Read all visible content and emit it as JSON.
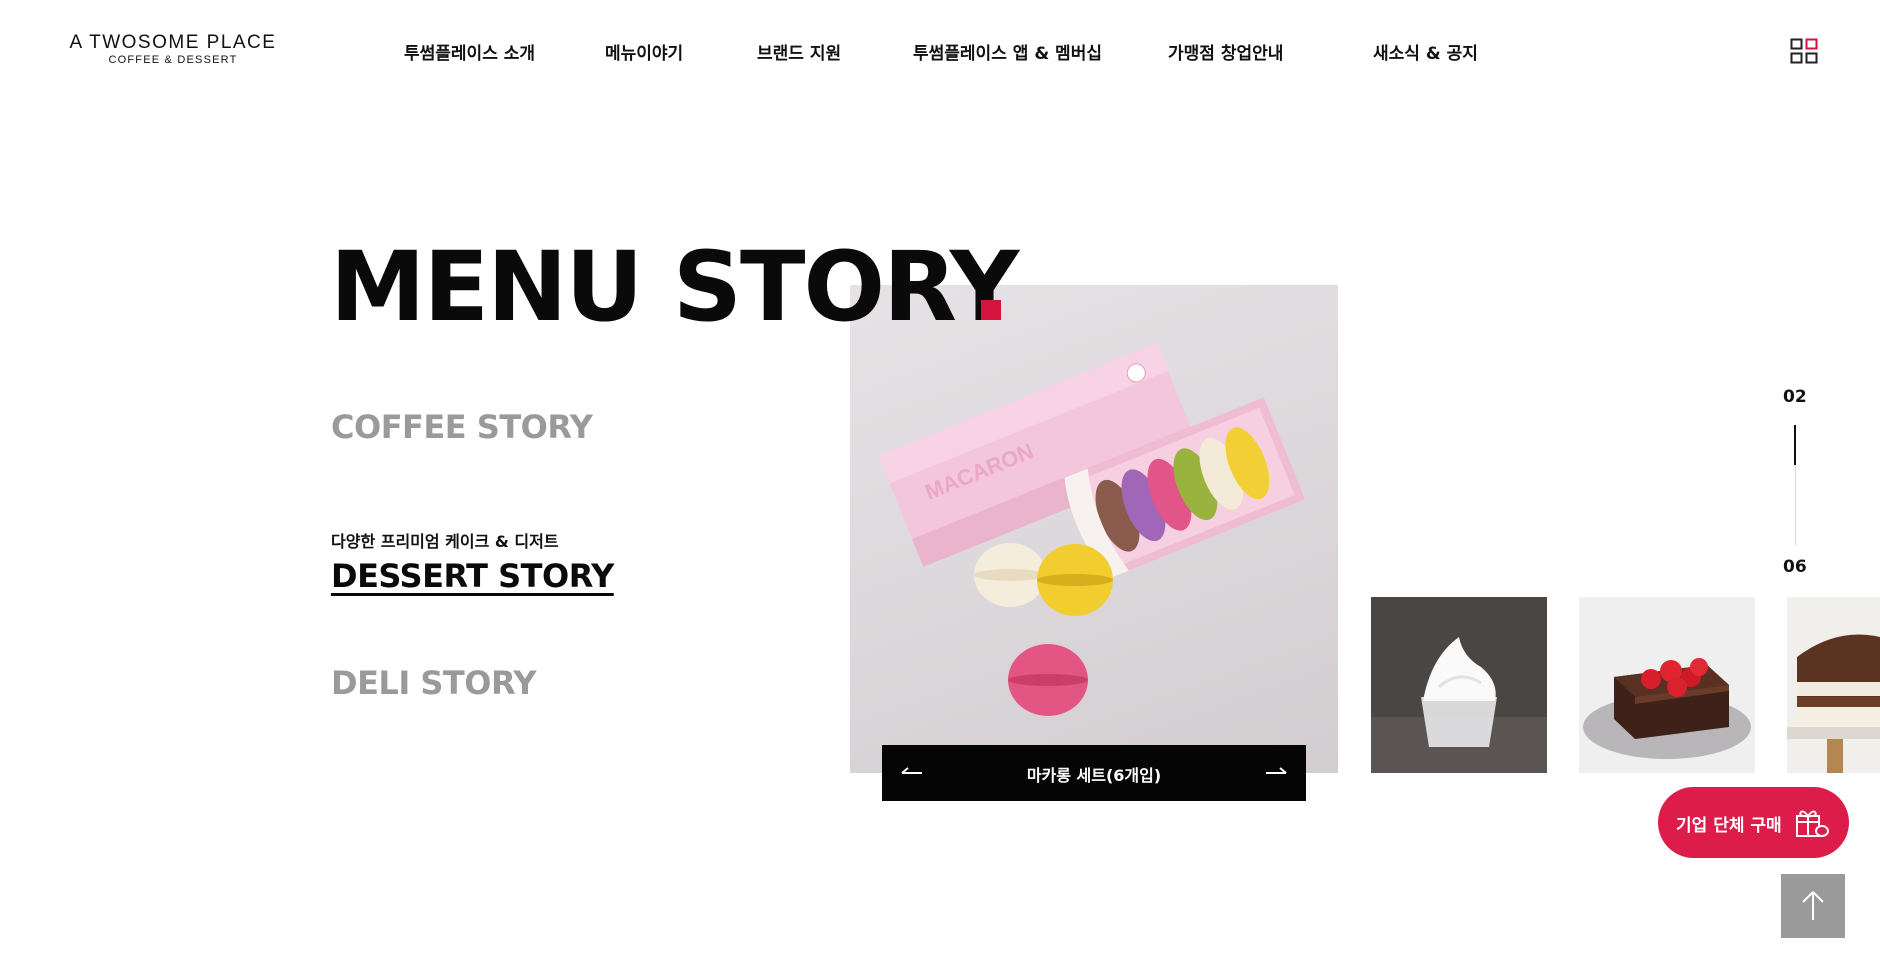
{
  "brand": {
    "name": "A TWOSOME PLACE",
    "tagline": "COFFEE & DESSERT"
  },
  "nav": {
    "items": [
      {
        "label": "투썸플레이스 소개"
      },
      {
        "label": "메뉴이야기"
      },
      {
        "label": "브랜드 지원"
      },
      {
        "label": "투썸플레이스 앱 & 멤버십"
      },
      {
        "label": "가맹점 창업안내"
      },
      {
        "label": "새소식 & 공지"
      }
    ],
    "menu_icon": "grid-menu-icon"
  },
  "section": {
    "title": "MENU STORY",
    "accent_color": "#d4133f",
    "categories": [
      {
        "label": "COFFEE STORY",
        "active": false
      },
      {
        "label": "DESSERT STORY",
        "active": true,
        "subtitle": "다양한 프리미엄 케이크 & 디저트"
      },
      {
        "label": "DELI STORY",
        "active": false
      }
    ]
  },
  "slider": {
    "main_image": "macaron-set-photo",
    "caption": "마카롱 세트(6개입)",
    "prev_icon": "arrow-left-icon",
    "next_icon": "arrow-right-icon",
    "thumbnails": [
      "whipped-cream-cup-photo",
      "strawberry-chocolate-cake-photo",
      "tiramisu-cake-photo"
    ],
    "current": "02",
    "total": "06"
  },
  "floating": {
    "corporate_label": "기업 단체 구매",
    "corporate_icon": "gift-icon",
    "corporate_color": "#dc1d4a",
    "top_icon": "arrow-up-icon"
  }
}
